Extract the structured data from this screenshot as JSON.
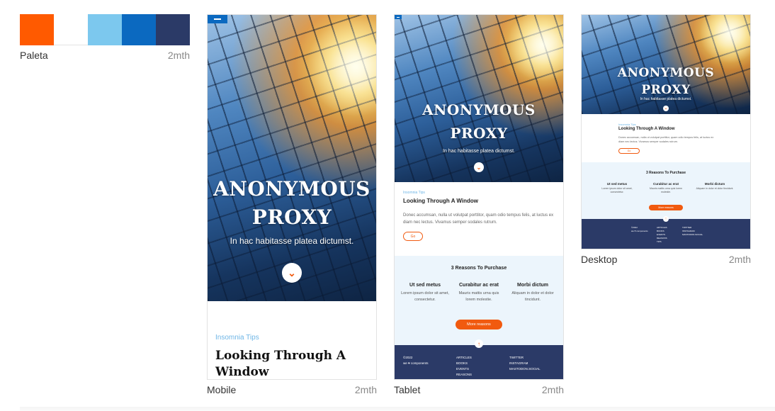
{
  "palette": {
    "name": "Paleta",
    "time": "2mth",
    "colors": [
      "#ff5a00",
      "#ffffff",
      "#7cc8ee",
      "#0b69c0",
      "#2b3a67"
    ]
  },
  "site": {
    "hero_title_line1": "ANONYMOUS",
    "hero_title_line2": "PROXY",
    "hero_subtitle": "In hac habitasse platea dictumst.",
    "article_tag": "Insomnia Tips",
    "article_title": "Looking Through A Window",
    "article_body": "Donec accumsan, nulla ut volutpat porttitor, quam odio tempus felis, at luctus ex diam nec lectus. Vivamus semper sodales rutrum.",
    "go_label": "Go",
    "reasons_title": "3 Reasons To Purchase",
    "reasons": [
      {
        "title": "Ut sed metus",
        "text": "Lorem ipsum dolor sit amet, consectetur."
      },
      {
        "title": "Curabitur ac erat",
        "text": "Mauris mattis urna quis lorem molestie."
      },
      {
        "title": "Morbi dictum",
        "text": "Aliquam in dolor et dolor tincidunt."
      }
    ],
    "more_label": "More reasons",
    "footer": {
      "copyright": "©2022",
      "credit": "we ♥ components",
      "links_col1": [
        "ARTICLES",
        "BOOKS",
        "EVENTS",
        "REASONS"
      ],
      "links_col2": [
        "TWITTER",
        "INSTAGRAM",
        "MASTODON.SOCIAL"
      ],
      "desktop_links_col1": [
        "ARTICLES",
        "BOOKS",
        "EVENTS",
        "REASONS",
        "TIPS"
      ]
    }
  },
  "cards": {
    "mobile": {
      "name": "Mobile",
      "time": "2mth"
    },
    "tablet": {
      "name": "Tablet",
      "time": "2mth"
    },
    "desktop": {
      "name": "Desktop",
      "time": "2mth"
    }
  },
  "icons": {
    "menu": "menu-icon",
    "down": "chevron-down-icon",
    "up": "arrow-up-icon"
  }
}
